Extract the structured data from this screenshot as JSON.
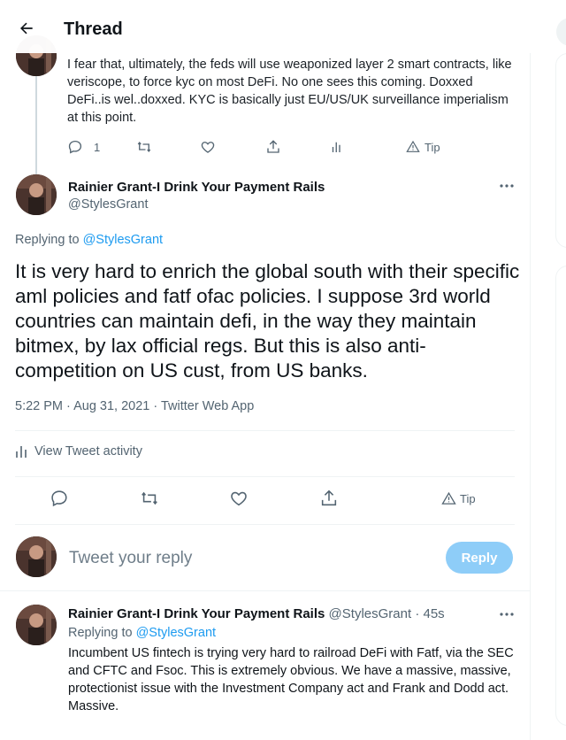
{
  "header": {
    "title": "Thread"
  },
  "parent_tweet": {
    "text": "I fear that, ultimately, the feds will use weaponized layer 2 smart contracts, like veriscope, to force kyc on most DeFi. No one sees this coming. Doxxed DeFi..is wel..doxxed. KYC is basically just EU/US/UK surveillance imperialism at this point.",
    "reply_count": "1",
    "tip_label": "Tip"
  },
  "main_tweet": {
    "author_name": "Rainier Grant-I Drink Your Payment Rails",
    "author_handle": "@StylesGrant",
    "replying_prefix": "Replying to",
    "replying_to": "@StylesGrant",
    "text": "It is very hard to enrich the global south with their specific aml policies and fatf ofac policies. I suppose 3rd world countries can maintain defi, in the way they maintain bitmex, by lax official regs. But this is also anti-competition on US cust, from US banks.",
    "time": "5:22 PM",
    "date": "Aug 31, 2021",
    "source": "Twitter Web App",
    "activity_label": "View Tweet activity",
    "tip_label": "Tip"
  },
  "compose": {
    "placeholder": "Tweet your reply",
    "reply_button": "Reply"
  },
  "reply_tweet": {
    "author_name": "Rainier Grant-I Drink Your Payment Rails",
    "author_handle": "@StylesGrant",
    "age": "45s",
    "replying_prefix": "Replying to",
    "replying_to": "@StylesGrant",
    "text": "Incumbent US fintech is trying very hard to railroad DeFi with Fatf, via the SEC and CFTC and Fsoc. This is extremely obvious. We have a massive, massive, protectionist issue with the Investment Company act and Frank and Dodd act. Massive."
  },
  "colors": {
    "accent": "#1d9bf0",
    "reply_button_disabled": "#8ecdf8",
    "secondary_text": "#536471",
    "divider": "#eff3f4"
  },
  "icons": [
    "back-arrow-icon",
    "reply-icon",
    "retweet-icon",
    "like-icon",
    "share-icon",
    "analytics-icon",
    "tip-icon",
    "more-icon"
  ]
}
